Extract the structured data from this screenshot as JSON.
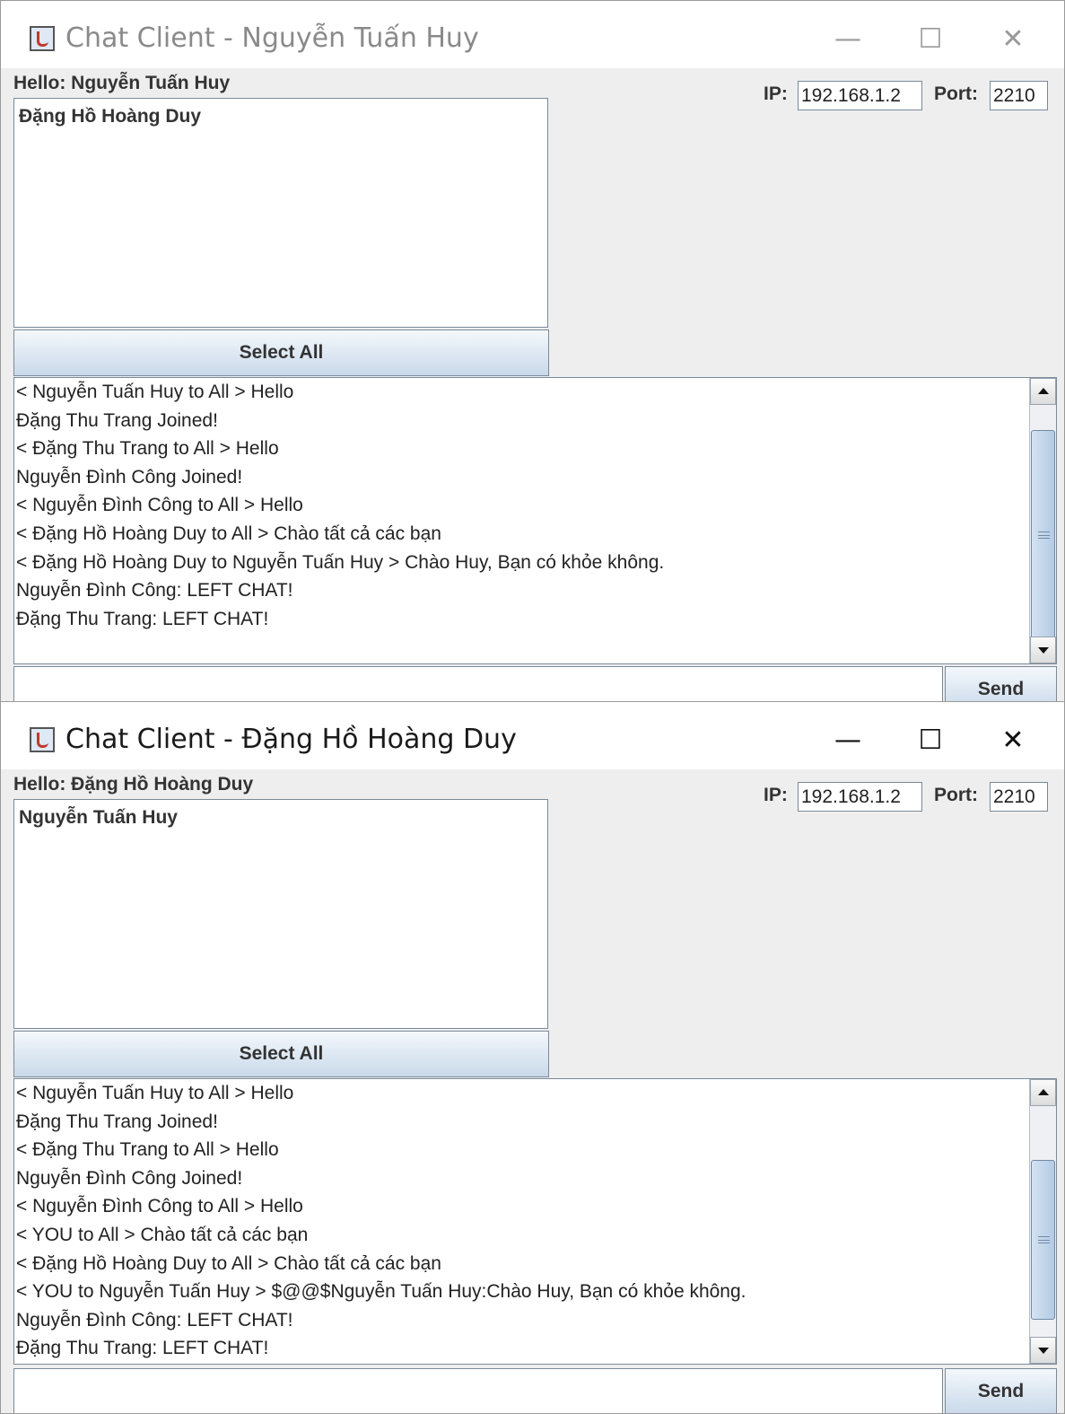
{
  "windows": [
    {
      "title": "Chat Client - Nguyễn Tuấn Huy",
      "hello": "Hello: Nguyễn Tuấn Huy",
      "ip_label": "IP:",
      "ip": "192.168.1.2",
      "port_label": "Port:",
      "port": "2210",
      "online_users": [
        "Đặng Hồ Hoàng Duy"
      ],
      "select_all_label": "Select All",
      "messages": [
        "< Nguyễn Tuấn Huy to All > Hello",
        "Đặng Thu Trang Joined!",
        "< Đặng Thu Trang to All > Hello",
        "Nguyễn Đình Công Joined!",
        "< Nguyễn Đình Công to All > Hello",
        "< Đặng Hồ Hoàng Duy to All > Chào tất cả các bạn",
        "< Đặng Hồ Hoàng Duy to Nguyễn Tuấn Huy > Chào Huy, Bạn có khỏe không.",
        "Nguyễn Đình Công: LEFT CHAT!",
        "Đặng Thu Trang: LEFT CHAT!"
      ],
      "input_value": "",
      "send_label": "Send",
      "active": false
    },
    {
      "title": "Chat Client - Đặng Hồ Hoàng Duy",
      "hello": "Hello: Đặng Hồ Hoàng Duy",
      "ip_label": "IP:",
      "ip": "192.168.1.2",
      "port_label": "Port:",
      "port": "2210",
      "online_users": [
        "Nguyễn Tuấn Huy"
      ],
      "select_all_label": "Select All",
      "messages": [
        "< Nguyễn Tuấn Huy to All > Hello",
        "Đặng Thu Trang Joined!",
        "< Đặng Thu Trang to All > Hello",
        "Nguyễn Đình Công Joined!",
        "< Nguyễn Đình Công to All > Hello",
        "< YOU to All > Chào tất cả các bạn",
        "< Đặng Hồ Hoàng Duy to All > Chào tất cả các bạn",
        "< YOU to Nguyễn Tuấn Huy > $@@$Nguyễn Tuấn Huy:Chào Huy, Bạn có khỏe không.",
        "Nguyễn Đình Công: LEFT CHAT!",
        "Đặng Thu Trang: LEFT CHAT!"
      ],
      "input_value": "",
      "send_label": "Send",
      "active": true
    }
  ],
  "icons": {
    "app": "java-app-icon",
    "minimize": "minimize-icon",
    "maximize": "maximize-icon",
    "close": "close-icon",
    "scroll_up": "arrow-up-icon",
    "scroll_down": "arrow-down-icon",
    "scroll_grip": "grip-icon"
  },
  "glyphs": {
    "minimize": "—",
    "maximize": "☐",
    "close": "✕"
  }
}
